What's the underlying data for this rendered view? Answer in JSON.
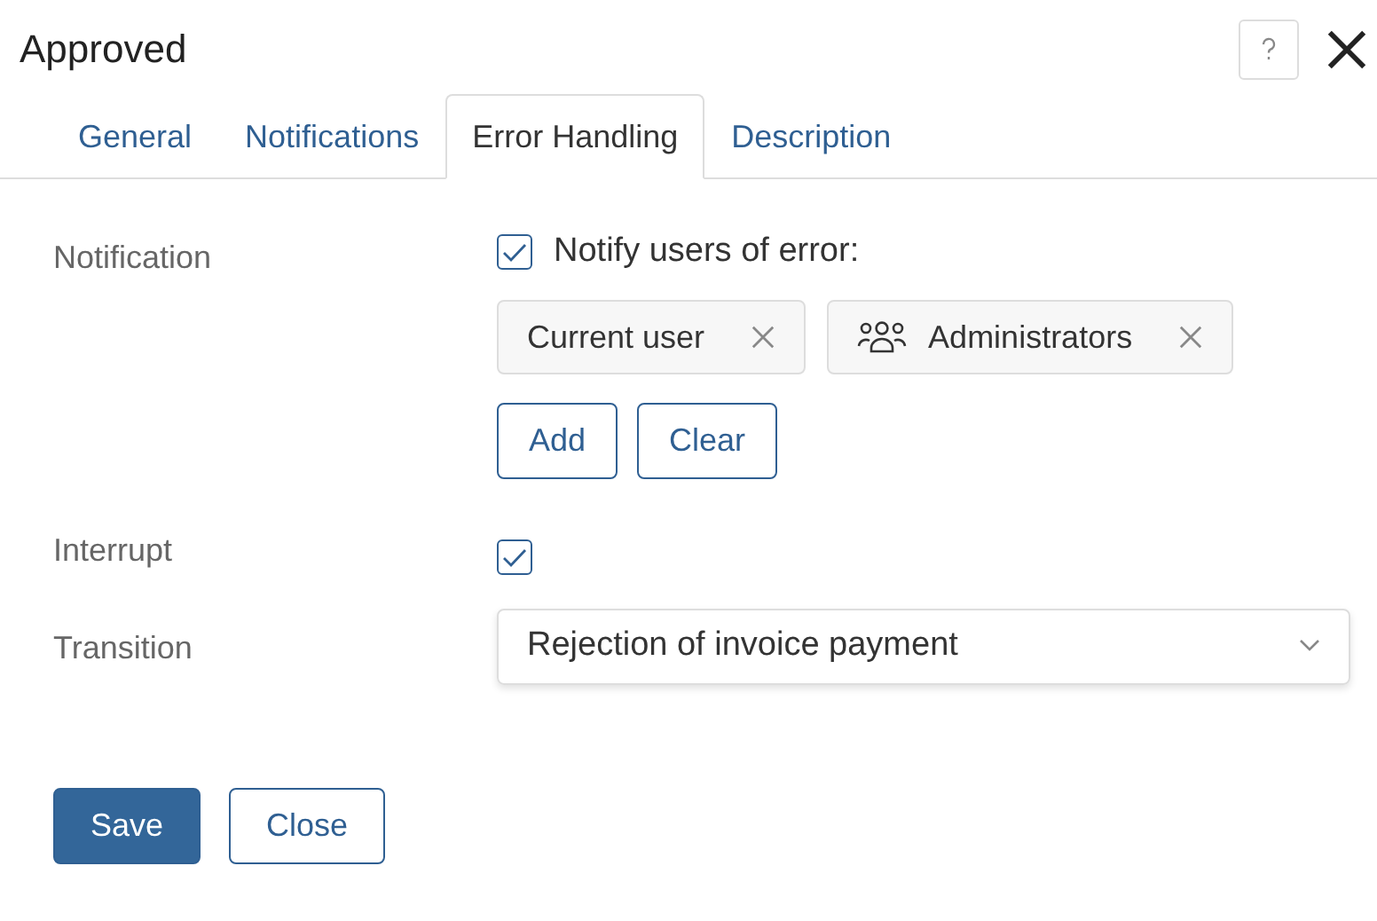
{
  "window": {
    "title": "Approved"
  },
  "tabs": [
    {
      "label": "General",
      "selected": false
    },
    {
      "label": "Notifications",
      "selected": false
    },
    {
      "label": "Error Handling",
      "selected": true
    },
    {
      "label": "Description",
      "selected": false
    }
  ],
  "notification": {
    "label": "Notification",
    "checkbox_label": "Notify users of error:",
    "checked": true,
    "recipients": [
      {
        "kind": "user",
        "name": "Current user"
      },
      {
        "kind": "group",
        "name": "Administrators"
      }
    ],
    "buttons": [
      "Add",
      "Clear"
    ]
  },
  "interrupt": {
    "label": "Interrupt",
    "checked": true
  },
  "transition": {
    "label": "Transition",
    "value": "Rejection of invoice payment"
  },
  "footer": [
    {
      "kind": "primary",
      "label": "Save"
    },
    {
      "kind": "secondary",
      "label": "Close"
    }
  ]
}
